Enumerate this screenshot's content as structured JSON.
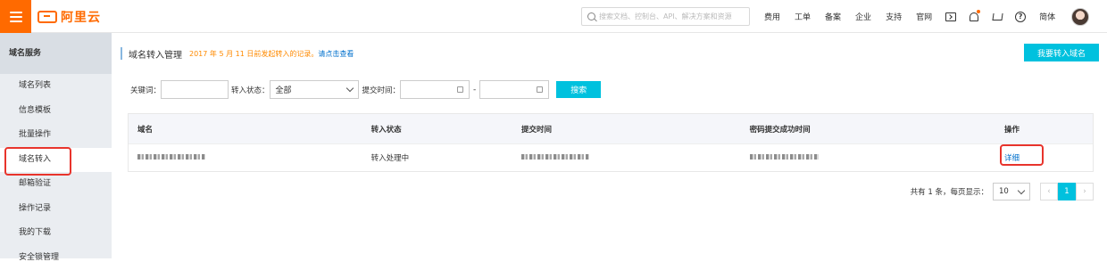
{
  "header": {
    "logo_text": "阿里云",
    "search_placeholder": "搜索文档、控制台、API、解决方案和资源",
    "links": [
      "费用",
      "工单",
      "备案",
      "企业",
      "支持",
      "官网"
    ],
    "lang": "简体"
  },
  "sidebar": {
    "title": "域名服务",
    "items": [
      {
        "label": "域名列表"
      },
      {
        "label": "信息模板"
      },
      {
        "label": "批量操作"
      },
      {
        "label": "域名转入"
      },
      {
        "label": "邮箱验证"
      },
      {
        "label": "操作记录"
      },
      {
        "label": "我的下载"
      },
      {
        "label": "安全锁管理"
      }
    ]
  },
  "page": {
    "title": "域名转入管理",
    "notice": "2017 年 5 月 11 日前发起转入的记录。",
    "notice_link": "请点击查看",
    "primary_button": "我要转入域名"
  },
  "filter": {
    "keyword_label": "关键词：",
    "keyword_value": "",
    "status_label": "转入状态：",
    "status_value": "全部",
    "time_label": "提交时间：",
    "dash": "-",
    "search_button": "搜索"
  },
  "table": {
    "headers": [
      "域名",
      "转入状态",
      "提交时间",
      "密码提交成功时间",
      "操作"
    ],
    "rows": [
      {
        "status": "转入处理中",
        "action": "详细"
      }
    ]
  },
  "pagination": {
    "summary": "共有 1 条，每页显示：",
    "page_size": "10",
    "prev": "‹",
    "current": "1",
    "next": "›"
  },
  "colors": {
    "brand": "#ff6a00",
    "primary": "#00c1de",
    "highlight": "#e8342c",
    "link": "#0070cc"
  }
}
